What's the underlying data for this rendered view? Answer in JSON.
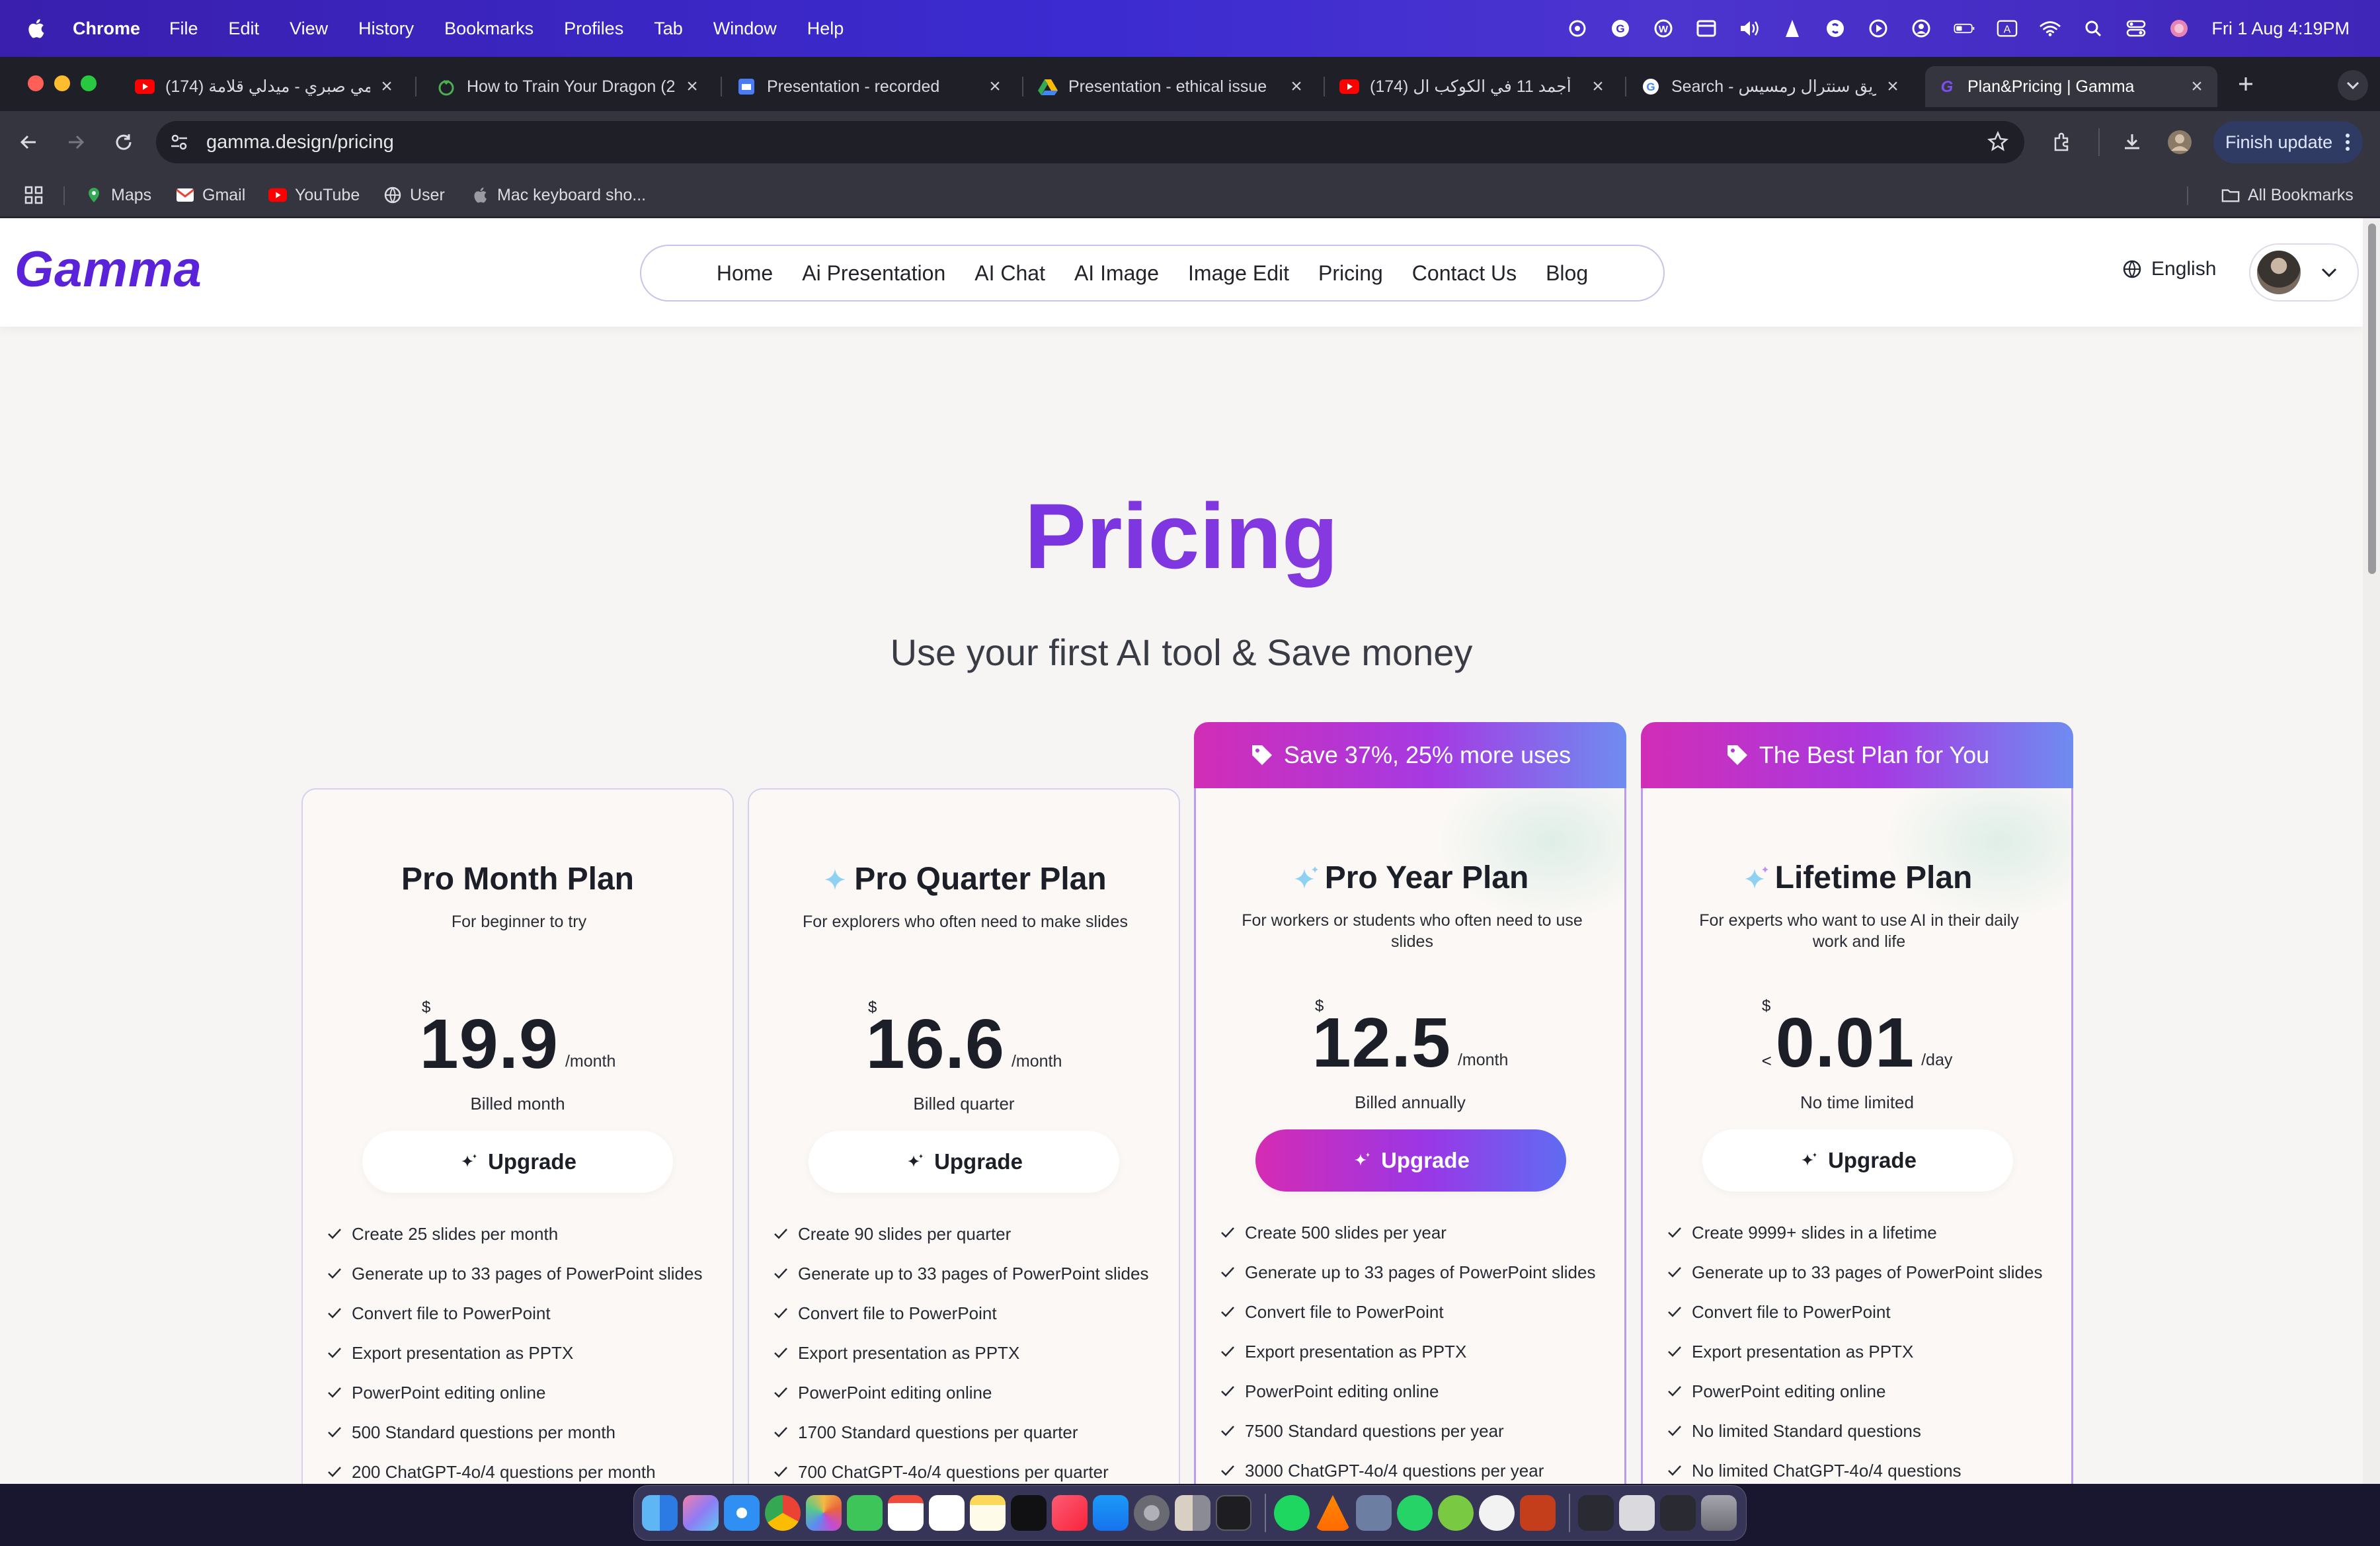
{
  "menubar": {
    "app": "Chrome",
    "items": [
      "File",
      "Edit",
      "View",
      "History",
      "Bookmarks",
      "Profiles",
      "Tab",
      "Window",
      "Help"
    ],
    "clock": "Fri 1 Aug  4:19PM"
  },
  "tabs": [
    {
      "title": "(174) رامي صبري - ميدلي قلامة",
      "icon": "youtube-icon",
      "active": false
    },
    {
      "title": "How to Train Your Dragon (2",
      "icon": "tomato-icon",
      "active": false
    },
    {
      "title": "Presentation - recorded",
      "icon": "slides-icon",
      "active": false
    },
    {
      "title": "Presentation - ethical issue",
      "icon": "drive-icon",
      "active": false
    },
    {
      "title": "(174) أجمد 11 في الكوكب ال",
      "icon": "youtube-icon",
      "active": false
    },
    {
      "title": "Search - حريق سنترال رمسيس",
      "icon": "google-icon",
      "active": false
    },
    {
      "title": "Plan&Pricing | Gamma",
      "icon": "gamma-icon",
      "active": true
    }
  ],
  "toolbar": {
    "url": "gamma.design/pricing",
    "finish_update": "Finish update"
  },
  "bookmarks": [
    "Maps",
    "Gmail",
    "YouTube",
    "User",
    "Mac keyboard sho...",
    "All Bookmarks"
  ],
  "site": {
    "logo": "Gamma",
    "nav": [
      "Home",
      "Ai Presentation",
      "AI Chat",
      "AI Image",
      "Image Edit",
      "Pricing",
      "Contact Us",
      "Blog"
    ],
    "language": "English",
    "title": "Pricing",
    "subtitle": "Use your first AI tool & Save money"
  },
  "plans": [
    {
      "name": "Pro Month Plan",
      "description": "For beginner to try",
      "currency": "$",
      "prefix": "",
      "price": "19.9",
      "period": "/month",
      "billed": "Billed month",
      "button": "Upgrade",
      "ribbon": "",
      "features": [
        "Create 25 slides per month",
        "Generate up to 33 pages of PowerPoint slides",
        "Convert file to PowerPoint",
        "Export presentation as PPTX",
        "PowerPoint editing online",
        "500 Standard questions per month",
        "200 ChatGPT-4o/4 questions per month"
      ]
    },
    {
      "name": "Pro Quarter Plan",
      "description": "For explorers who often need to make slides",
      "currency": "$",
      "prefix": "",
      "price": "16.6",
      "period": "/month",
      "billed": "Billed quarter",
      "button": "Upgrade",
      "ribbon": "",
      "features": [
        "Create 90 slides per quarter",
        "Generate up to 33 pages of PowerPoint slides",
        "Convert file to PowerPoint",
        "Export presentation as PPTX",
        "PowerPoint editing online",
        "1700 Standard questions per quarter",
        "700 ChatGPT-4o/4 questions per quarter"
      ]
    },
    {
      "name": "Pro Year Plan",
      "description": "For workers or students who often need to use slides",
      "currency": "$",
      "prefix": "",
      "price": "12.5",
      "period": "/month",
      "billed": "Billed annually",
      "button": "Upgrade",
      "ribbon": "Save 37%, 25% more uses",
      "features": [
        "Create 500 slides per year",
        "Generate up to 33 pages of PowerPoint slides",
        "Convert file to PowerPoint",
        "Export presentation as PPTX",
        "PowerPoint editing online",
        "7500 Standard questions per year",
        "3000 ChatGPT-4o/4 questions per year"
      ]
    },
    {
      "name": "Lifetime Plan",
      "description": "For experts who want to use AI in their daily work and life",
      "currency": "$",
      "prefix": "<",
      "price": "0.01",
      "period": "/day",
      "billed": "No time limited",
      "button": "Upgrade",
      "ribbon": "The Best Plan for You",
      "features": [
        "Create 9999+ slides in a lifetime",
        "Generate up to 33 pages of PowerPoint slides",
        "Convert file to PowerPoint",
        "Export presentation as PPTX",
        "PowerPoint editing online",
        "No limited Standard questions",
        "No limited ChatGPT-4o/4 questions"
      ]
    }
  ],
  "colors": {
    "brand": "#5a22d9",
    "gradient_start": "#d52bb3",
    "gradient_end": "#5f6cf2"
  }
}
